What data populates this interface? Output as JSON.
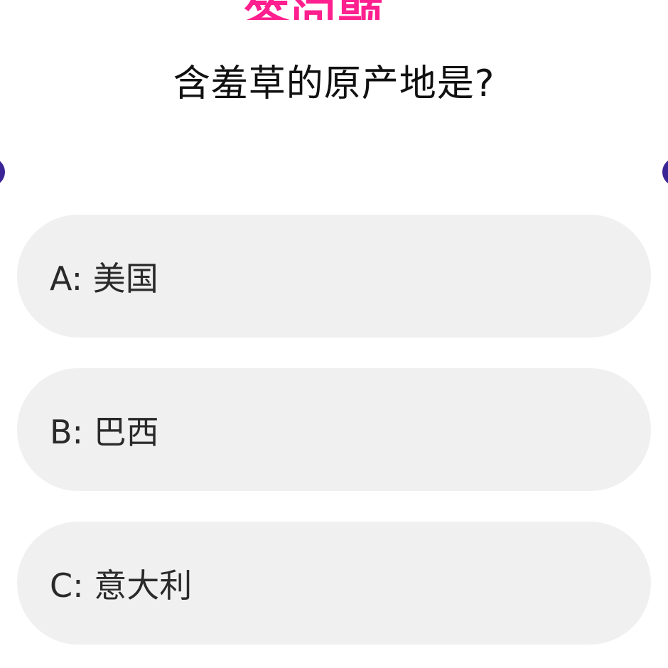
{
  "banner": {
    "logo_text": "答问题"
  },
  "question": {
    "text": "含羞草的原产地是?"
  },
  "options": [
    {
      "label": "A: 美国"
    },
    {
      "label": "B: 巴西"
    },
    {
      "label": "C: 意大利"
    }
  ],
  "colors": {
    "logo": "#ff1f8e",
    "option_bg": "#f0f0f0",
    "side_dot": "#3b2496",
    "question_text": "#111111"
  }
}
